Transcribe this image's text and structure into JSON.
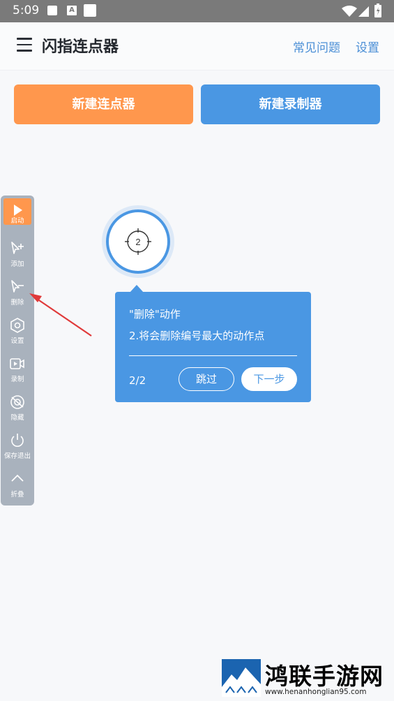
{
  "status_bar": {
    "time": "5:09"
  },
  "header": {
    "title": "闪指连点器",
    "faq": "常见问题",
    "settings": "设置"
  },
  "actions": {
    "new_clicker": "新建连点器",
    "new_recorder": "新建录制器"
  },
  "target": {
    "number": "2"
  },
  "tooltip": {
    "title": "\"删除\"动作",
    "description": "2.将会删除编号最大的动作点",
    "page": "2/2",
    "skip": "跳过",
    "next": "下一步"
  },
  "sidebar": {
    "items": [
      {
        "label": "启动",
        "icon": "play-icon"
      },
      {
        "label": "添加",
        "icon": "add-cursor-icon"
      },
      {
        "label": "删除",
        "icon": "remove-cursor-icon"
      },
      {
        "label": "设置",
        "icon": "hexagon-gear-icon"
      },
      {
        "label": "录制",
        "icon": "record-video-icon"
      },
      {
        "label": "隐藏",
        "icon": "hide-eye-icon"
      },
      {
        "label": "保存退出",
        "icon": "power-icon"
      },
      {
        "label": "折叠",
        "icon": "chevron-up-icon"
      }
    ]
  },
  "watermark": {
    "name": "鸿联手游网",
    "url": "www.henanhonglian95.com"
  },
  "colors": {
    "accent_orange": "#ff974d",
    "accent_blue": "#4a97e3",
    "sidebar_bg": "#a9b2bd",
    "status_bar": "#7a7a7a"
  }
}
